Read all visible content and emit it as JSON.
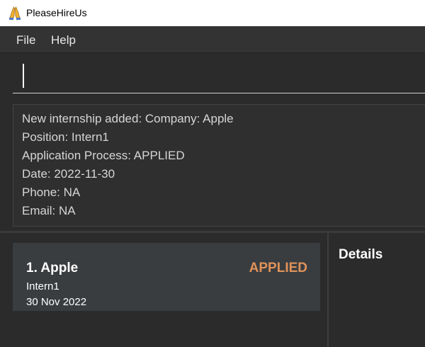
{
  "window": {
    "title": "PleaseHireUs",
    "icon": "praying-hands-icon"
  },
  "menu": {
    "file": "File",
    "help": "Help"
  },
  "command": {
    "value": "",
    "placeholder": ""
  },
  "result": {
    "lines": [
      "New internship added: Company: Apple",
      "Position: Intern1",
      "Application Process: APPLIED",
      "Date: 2022-11-30",
      "Phone: NA",
      "Email: NA"
    ]
  },
  "internships": [
    {
      "index_title": "1.  Apple",
      "status": "APPLIED",
      "position": "Intern1",
      "date": "30 Nov 2022"
    }
  ],
  "details": {
    "title": "Details"
  },
  "colors": {
    "status_applied": "#e0935a",
    "background": "#2b2b2b",
    "card": "#3a3d40"
  }
}
